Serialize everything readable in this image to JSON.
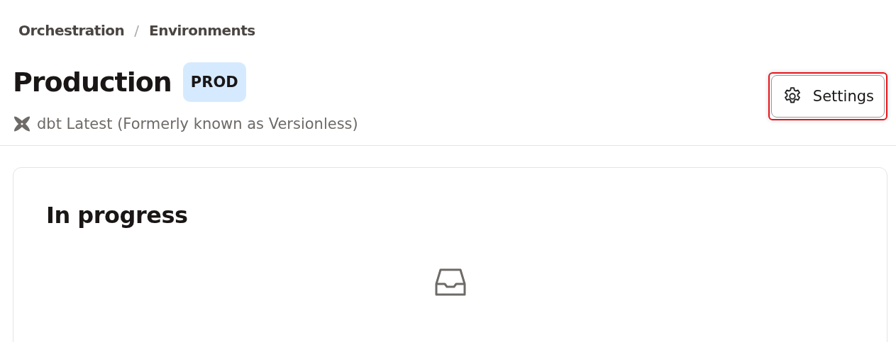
{
  "breadcrumb": [
    {
      "label": "Orchestration"
    },
    {
      "label": "Environments"
    }
  ],
  "breadcrumb_separator": "/",
  "title": "Production",
  "badge": "PROD",
  "subtitle": "dbt Latest (Formerly known as Versionless)",
  "settings_button": {
    "label": "Settings",
    "highlighted": true
  },
  "card": {
    "heading": "In progress"
  }
}
